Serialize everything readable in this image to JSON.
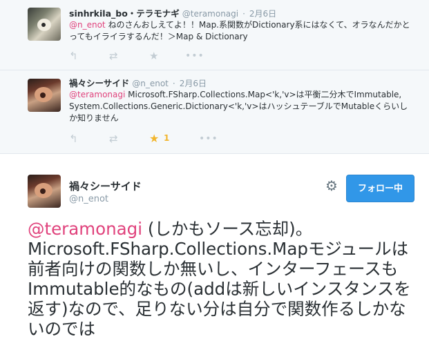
{
  "thread": [
    {
      "name": "sinhrkila_bo・テラモナギ",
      "handle": "@teramonagi",
      "time": "2月6日",
      "mention": "@n_enot",
      "text": " ねのさんおしえてよ！！Map.系関数がDictionary系にはなくて、オラなんだかとってもイライラするんだ！＞Map & Dictionary"
    },
    {
      "name": "禍々シーサイド",
      "handle": "@n_enot",
      "time": "2月6日",
      "mention": "@teramonagi",
      "text": " Microsoft.FSharp.Collections.Map<'k,'v>は平衡二分木でImmutable, System.Collections.Generic.Dictionary<'k,'v>はハッシュテーブルでMutableくらいしか知りません",
      "favorite_count": "1"
    }
  ],
  "main": {
    "name": "禍々シーサイド",
    "handle": "@n_enot",
    "follow_label": "フォロー中",
    "mention": "@teramonagi",
    "text": " (しかもソース忘却)。Microsoft.FSharp.Collections.Mapモジュールは前者向けの関数しか無いし、インターフェースもImmutable的なもの(addは新しいインスタンスを返す)なので、足りない分は自分で関数作るしかないのでは"
  },
  "icons": {
    "reply": "reply-icon",
    "retweet": "retweet-icon",
    "favorite": "star-icon",
    "more": "more-icon",
    "settings": "gear-icon"
  },
  "colors": {
    "mention": "#e0427c",
    "follow_button": "#3197e8",
    "favorite_active": "#f2b52c"
  }
}
